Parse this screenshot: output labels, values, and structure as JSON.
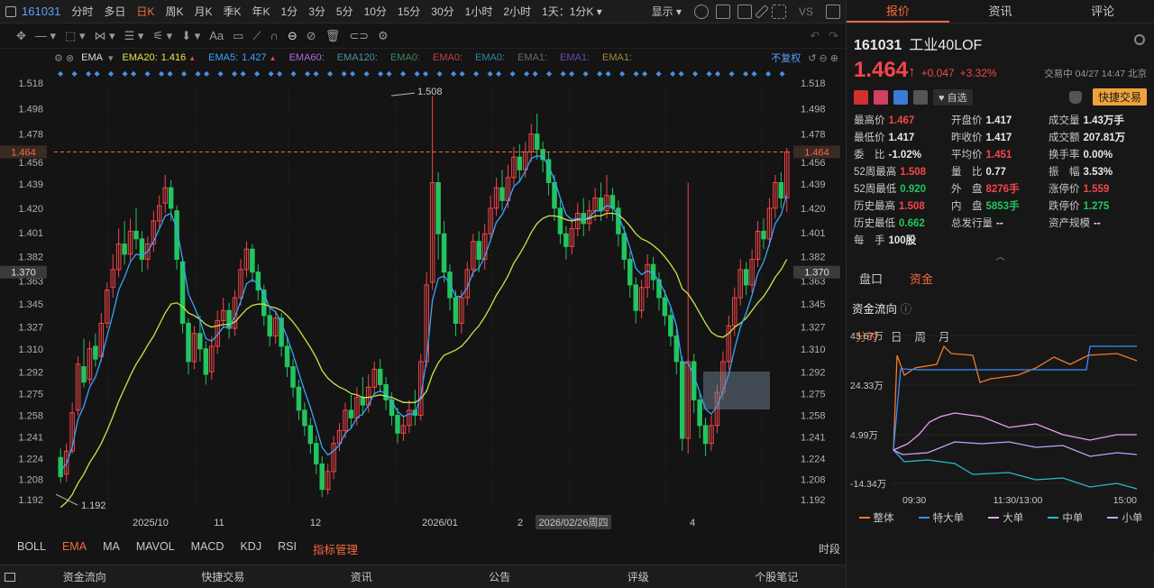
{
  "topbar": {
    "code": "161031",
    "periods": [
      "分时",
      "多日",
      "日K",
      "周K",
      "月K",
      "季K",
      "年K",
      "1分",
      "3分",
      "5分",
      "10分",
      "15分",
      "30分",
      "1小时",
      "2小时"
    ],
    "active_period": "日K",
    "range_select": "1天：1分K",
    "display_label": "显示",
    "vs_label": "VS"
  },
  "indicator_bar": {
    "type": "EMA",
    "items": [
      {
        "label": "EMA20:",
        "value": "1.416",
        "color": "#e6e649"
      },
      {
        "label": "EMA5:",
        "value": "1.427",
        "color": "#3ba3ff"
      },
      {
        "label": "EMA60:",
        "value": "",
        "color": "#b06ad6"
      },
      {
        "label": "EMA120:",
        "value": "",
        "color": "#4a90a4"
      },
      {
        "label": "EMA0:",
        "value": "",
        "color": "#3a8a5a"
      },
      {
        "label": "EMA0:",
        "value": "",
        "color": "#c04040"
      },
      {
        "label": "EMA0:",
        "value": "",
        "color": "#2a8aa4"
      },
      {
        "label": "EMA1:",
        "value": "",
        "color": "#6a6a6a"
      },
      {
        "label": "EMA1:",
        "value": "",
        "color": "#6a4aa4"
      },
      {
        "label": "EMA1:",
        "value": "",
        "color": "#a48a3a"
      }
    ],
    "rights_label": "不复权"
  },
  "chart_data": {
    "type": "candlestick",
    "y_ticks": [
      "1.518",
      "1.498",
      "1.478",
      "1.456",
      "1.439",
      "1.420",
      "1.401",
      "1.382",
      "1.363",
      "1.345",
      "1.327",
      "1.310",
      "1.292",
      "1.275",
      "1.258",
      "1.241",
      "1.224",
      "1.208",
      "1.192"
    ],
    "ylim": [
      1.185,
      1.525
    ],
    "current_price_label": "1.464",
    "crosshair_label": "1.370",
    "high_annotation": "1.508",
    "low_annotation": "1.192",
    "x_labels": [
      "2025/10",
      "11",
      "12",
      "2026/01",
      "2",
      "2026/02/26周四",
      "4"
    ],
    "candles": [
      [
        1.225,
        1.21,
        1.232,
        1.205
      ],
      [
        1.212,
        1.23,
        1.236,
        1.206
      ],
      [
        1.23,
        1.26,
        1.268,
        1.228
      ],
      [
        1.262,
        1.298,
        1.304,
        1.258
      ],
      [
        1.296,
        1.284,
        1.318,
        1.28
      ],
      [
        1.286,
        1.31,
        1.316,
        1.282
      ],
      [
        1.312,
        1.302,
        1.322,
        1.296
      ],
      [
        1.304,
        1.33,
        1.338,
        1.3
      ],
      [
        1.33,
        1.356,
        1.362,
        1.326
      ],
      [
        1.358,
        1.372,
        1.384,
        1.35
      ],
      [
        1.372,
        1.392,
        1.404,
        1.366
      ],
      [
        1.392,
        1.384,
        1.41,
        1.376
      ],
      [
        1.384,
        1.402,
        1.412,
        1.378
      ],
      [
        1.402,
        1.396,
        1.42,
        1.388
      ],
      [
        1.396,
        1.38,
        1.402,
        1.37
      ],
      [
        1.38,
        1.392,
        1.398,
        1.372
      ],
      [
        1.392,
        1.41,
        1.418,
        1.386
      ],
      [
        1.41,
        1.422,
        1.43,
        1.404
      ],
      [
        1.424,
        1.436,
        1.446,
        1.416
      ],
      [
        1.436,
        1.42,
        1.442,
        1.41
      ],
      [
        1.418,
        1.38,
        1.422,
        1.372
      ],
      [
        1.378,
        1.33,
        1.382,
        1.322
      ],
      [
        1.33,
        1.3,
        1.334,
        1.29
      ],
      [
        1.3,
        1.322,
        1.328,
        1.294
      ],
      [
        1.322,
        1.31,
        1.336,
        1.3
      ],
      [
        1.31,
        1.29,
        1.316,
        1.282
      ],
      [
        1.292,
        1.312,
        1.32,
        1.286
      ],
      [
        1.312,
        1.332,
        1.34,
        1.306
      ],
      [
        1.332,
        1.34,
        1.35,
        1.326
      ],
      [
        1.34,
        1.326,
        1.346,
        1.318
      ],
      [
        1.326,
        1.35,
        1.356,
        1.32
      ],
      [
        1.35,
        1.372,
        1.38,
        1.344
      ],
      [
        1.372,
        1.388,
        1.394,
        1.366
      ],
      [
        1.388,
        1.37,
        1.392,
        1.362
      ],
      [
        1.37,
        1.356,
        1.376,
        1.348
      ],
      [
        1.356,
        1.336,
        1.36,
        1.328
      ],
      [
        1.336,
        1.32,
        1.342,
        1.312
      ],
      [
        1.32,
        1.334,
        1.34,
        1.314
      ],
      [
        1.334,
        1.312,
        1.338,
        1.304
      ],
      [
        1.312,
        1.296,
        1.318,
        1.288
      ],
      [
        1.296,
        1.28,
        1.302,
        1.272
      ],
      [
        1.28,
        1.262,
        1.286,
        1.254
      ],
      [
        1.262,
        1.25,
        1.268,
        1.242
      ],
      [
        1.25,
        1.236,
        1.256,
        1.228
      ],
      [
        1.236,
        1.22,
        1.242,
        1.212
      ],
      [
        1.22,
        1.2,
        1.226,
        1.194
      ],
      [
        1.2,
        1.214,
        1.22,
        1.196
      ],
      [
        1.214,
        1.236,
        1.242,
        1.208
      ],
      [
        1.236,
        1.246,
        1.252,
        1.23
      ],
      [
        1.246,
        1.262,
        1.268,
        1.24
      ],
      [
        1.262,
        1.256,
        1.274,
        1.248
      ],
      [
        1.256,
        1.272,
        1.28,
        1.25
      ],
      [
        1.272,
        1.266,
        1.288,
        1.258
      ],
      [
        1.266,
        1.28,
        1.29,
        1.26
      ],
      [
        1.28,
        1.294,
        1.3,
        1.274
      ],
      [
        1.294,
        1.282,
        1.302,
        1.276
      ],
      [
        1.282,
        1.27,
        1.288,
        1.262
      ],
      [
        1.27,
        1.258,
        1.276,
        1.25
      ],
      [
        1.258,
        1.244,
        1.264,
        1.236
      ],
      [
        1.244,
        1.25,
        1.258,
        1.238
      ],
      [
        1.25,
        1.262,
        1.27,
        1.244
      ],
      [
        1.262,
        1.258,
        1.278,
        1.25
      ],
      [
        1.258,
        1.3,
        1.306,
        1.254
      ],
      [
        1.3,
        1.36,
        1.37,
        1.296
      ],
      [
        1.362,
        1.44,
        1.508,
        1.356
      ],
      [
        1.44,
        1.4,
        1.448,
        1.38
      ],
      [
        1.4,
        1.37,
        1.41,
        1.362
      ],
      [
        1.37,
        1.35,
        1.376,
        1.34
      ],
      [
        1.35,
        1.33,
        1.356,
        1.32
      ],
      [
        1.33,
        1.35,
        1.356,
        1.322
      ],
      [
        1.35,
        1.372,
        1.378,
        1.344
      ],
      [
        1.372,
        1.394,
        1.4,
        1.366
      ],
      [
        1.394,
        1.38,
        1.402,
        1.37
      ],
      [
        1.38,
        1.4,
        1.408,
        1.372
      ],
      [
        1.4,
        1.42,
        1.43,
        1.394
      ],
      [
        1.42,
        1.436,
        1.444,
        1.414
      ],
      [
        1.436,
        1.426,
        1.45,
        1.418
      ],
      [
        1.426,
        1.444,
        1.454,
        1.42
      ],
      [
        1.444,
        1.46,
        1.468,
        1.438
      ],
      [
        1.46,
        1.45,
        1.47,
        1.44
      ],
      [
        1.45,
        1.464,
        1.472,
        1.444
      ],
      [
        1.464,
        1.478,
        1.486,
        1.456
      ],
      [
        1.478,
        1.466,
        1.494,
        1.458
      ],
      [
        1.466,
        1.458,
        1.472,
        1.448
      ],
      [
        1.458,
        1.44,
        1.464,
        1.43
      ],
      [
        1.44,
        1.42,
        1.446,
        1.41
      ],
      [
        1.42,
        1.4,
        1.426,
        1.392
      ],
      [
        1.4,
        1.39,
        1.406,
        1.38
      ],
      [
        1.39,
        1.404,
        1.412,
        1.384
      ],
      [
        1.404,
        1.416,
        1.424,
        1.398
      ],
      [
        1.416,
        1.408,
        1.428,
        1.398
      ],
      [
        1.408,
        1.418,
        1.426,
        1.402
      ],
      [
        1.418,
        1.428,
        1.436,
        1.41
      ],
      [
        1.428,
        1.418,
        1.44,
        1.41
      ],
      [
        1.418,
        1.43,
        1.446,
        1.412
      ],
      [
        1.43,
        1.42,
        1.436,
        1.41
      ],
      [
        1.42,
        1.4,
        1.426,
        1.39
      ],
      [
        1.4,
        1.38,
        1.406,
        1.372
      ],
      [
        1.38,
        1.36,
        1.386,
        1.35
      ],
      [
        1.36,
        1.34,
        1.366,
        1.33
      ],
      [
        1.34,
        1.358,
        1.364,
        1.334
      ],
      [
        1.358,
        1.376,
        1.384,
        1.35
      ],
      [
        1.376,
        1.364,
        1.382,
        1.356
      ],
      [
        1.364,
        1.35,
        1.37,
        1.34
      ],
      [
        1.35,
        1.336,
        1.356,
        1.328
      ],
      [
        1.336,
        1.32,
        1.342,
        1.312
      ],
      [
        1.32,
        1.3,
        1.326,
        1.29
      ],
      [
        1.3,
        1.24,
        1.304,
        1.23
      ],
      [
        1.24,
        1.3,
        1.44,
        1.228
      ],
      [
        1.3,
        1.27,
        1.306,
        1.26
      ],
      [
        1.27,
        1.25,
        1.276,
        1.24
      ],
      [
        1.25,
        1.236,
        1.256,
        1.226
      ],
      [
        1.236,
        1.25,
        1.258,
        1.23
      ],
      [
        1.25,
        1.276,
        1.282,
        1.244
      ],
      [
        1.276,
        1.3,
        1.308,
        1.27
      ],
      [
        1.3,
        1.328,
        1.336,
        1.294
      ],
      [
        1.328,
        1.35,
        1.358,
        1.32
      ],
      [
        1.35,
        1.372,
        1.38,
        1.344
      ],
      [
        1.372,
        1.36,
        1.378,
        1.352
      ],
      [
        1.36,
        1.38,
        1.388,
        1.354
      ],
      [
        1.38,
        1.402,
        1.41,
        1.374
      ],
      [
        1.402,
        1.396,
        1.412,
        1.388
      ],
      [
        1.396,
        1.42,
        1.428,
        1.39
      ],
      [
        1.42,
        1.44,
        1.446,
        1.412
      ],
      [
        1.44,
        1.428,
        1.448,
        1.42
      ],
      [
        1.428,
        1.464,
        1.467,
        1.417
      ]
    ],
    "ema5": [
      1.215,
      1.22,
      1.233,
      1.255,
      1.265,
      1.28,
      1.288,
      1.302,
      1.32,
      1.337,
      1.356,
      1.366,
      1.378,
      1.384,
      1.383,
      1.386,
      1.394,
      1.404,
      1.414,
      1.416,
      1.404,
      1.38,
      1.353,
      1.343,
      1.332,
      1.318,
      1.316,
      1.321,
      1.327,
      1.327,
      1.335,
      1.347,
      1.361,
      1.364,
      1.361,
      1.353,
      1.342,
      1.339,
      1.33,
      1.319,
      1.306,
      1.291,
      1.277,
      1.264,
      1.249,
      1.233,
      1.227,
      1.23,
      1.235,
      1.244,
      1.248,
      1.256,
      1.259,
      1.266,
      1.275,
      1.277,
      1.275,
      1.269,
      1.261,
      1.257,
      1.259,
      1.259,
      1.273,
      1.302,
      1.348,
      1.365,
      1.367,
      1.361,
      1.351,
      1.351,
      1.358,
      1.37,
      1.373,
      1.382,
      1.395,
      1.409,
      1.415,
      1.425,
      1.437,
      1.441,
      1.449,
      1.459,
      1.461,
      1.46,
      1.453,
      1.442,
      1.428,
      1.415,
      1.411,
      1.412,
      1.411,
      1.413,
      1.418,
      1.418,
      1.422,
      1.421,
      1.414,
      1.403,
      1.389,
      1.373,
      1.368,
      1.371,
      1.369,
      1.363,
      1.354,
      1.343,
      1.328,
      1.299,
      1.299,
      1.289,
      1.276,
      1.263,
      1.259,
      1.265,
      1.277,
      1.29,
      1.31,
      1.327,
      1.338,
      1.352,
      1.369,
      1.378,
      1.392,
      1.408,
      1.415,
      1.431
    ],
    "ema20": [
      1.186,
      1.19,
      1.196,
      1.205,
      1.212,
      1.221,
      1.228,
      1.236,
      1.246,
      1.257,
      1.269,
      1.279,
      1.289,
      1.298,
      1.305,
      1.313,
      1.32,
      1.329,
      1.338,
      1.345,
      1.346,
      1.343,
      1.338,
      1.336,
      1.333,
      1.329,
      1.327,
      1.328,
      1.329,
      1.329,
      1.331,
      1.336,
      1.341,
      1.344,
      1.345,
      1.345,
      1.343,
      1.342,
      1.34,
      1.336,
      1.331,
      1.325,
      1.318,
      1.311,
      1.303,
      1.293,
      1.287,
      1.283,
      1.28,
      1.278,
      1.275,
      1.274,
      1.272,
      1.272,
      1.273,
      1.274,
      1.273,
      1.272,
      1.27,
      1.268,
      1.268,
      1.268,
      1.271,
      1.277,
      1.29,
      1.299,
      1.305,
      1.307,
      1.309,
      1.312,
      1.317,
      1.323,
      1.328,
      1.335,
      1.343,
      1.352,
      1.359,
      1.367,
      1.377,
      1.384,
      1.392,
      1.401,
      1.408,
      1.412,
      1.414,
      1.414,
      1.413,
      1.411,
      1.41,
      1.411,
      1.411,
      1.412,
      1.414,
      1.414,
      1.416,
      1.416,
      1.415,
      1.411,
      1.406,
      1.4,
      1.396,
      1.394,
      1.391,
      1.387,
      1.382,
      1.376,
      1.369,
      1.357,
      1.353,
      1.346,
      1.338,
      1.33,
      1.323,
      1.32,
      1.319,
      1.322,
      1.327,
      1.33,
      1.334,
      1.34,
      1.346,
      1.351,
      1.358,
      1.366,
      1.372,
      1.38
    ]
  },
  "bottom_tabs": [
    "BOLL",
    "EMA",
    "MA",
    "MAVOL",
    "MACD",
    "KDJ",
    "RSI",
    "指标管理"
  ],
  "bottom_active": "EMA",
  "bottom_right": "时段",
  "footer": [
    "资金流向",
    "快捷交易",
    "资讯",
    "公告",
    "评级",
    "个股笔记"
  ],
  "right_panel": {
    "tabs": [
      "报价",
      "资讯",
      "评论"
    ],
    "active_tab": "报价",
    "stock_code": "161031",
    "stock_name": "工业40LOF",
    "price": "1.464",
    "change": "+0.047",
    "change_pct": "+3.32%",
    "status": "交易中 04/27 14:47 北京",
    "watch_label": "自选",
    "quick_trade": "快捷交易",
    "quotes": [
      [
        {
          "k": "最高价",
          "v": "1.467",
          "c": "red"
        },
        {
          "k": "开盘价",
          "v": "1.417",
          "c": "white"
        },
        {
          "k": "成交量",
          "v": "1.43万手",
          "c": "white"
        }
      ],
      [
        {
          "k": "最低价",
          "v": "1.417",
          "c": "white"
        },
        {
          "k": "昨收价",
          "v": "1.417",
          "c": "white"
        },
        {
          "k": "成交额",
          "v": "207.81万",
          "c": "white"
        }
      ],
      [
        {
          "k": "委　比",
          "v": "-1.02%",
          "c": "white"
        },
        {
          "k": "平均价",
          "v": "1.451",
          "c": "red"
        },
        {
          "k": "换手率",
          "v": "0.00%",
          "c": "white"
        }
      ],
      [
        {
          "k": "52周最高",
          "v": "1.508",
          "c": "red"
        },
        {
          "k": "量　比",
          "v": "0.77",
          "c": "white"
        },
        {
          "k": "振　幅",
          "v": "3.53%",
          "c": "white"
        }
      ],
      [
        {
          "k": "52周最低",
          "v": "0.920",
          "c": "green"
        },
        {
          "k": "外　盘",
          "v": "8276手",
          "c": "red"
        },
        {
          "k": "涨停价",
          "v": "1.559",
          "c": "red"
        }
      ],
      [
        {
          "k": "历史最高",
          "v": "1.508",
          "c": "red"
        },
        {
          "k": "内　盘",
          "v": "5853手",
          "c": "green"
        },
        {
          "k": "跌停价",
          "v": "1.275",
          "c": "green"
        }
      ],
      [
        {
          "k": "历史最低",
          "v": "0.662",
          "c": "green"
        },
        {
          "k": "总发行量",
          "v": "--",
          "c": "white"
        },
        {
          "k": "资产规模",
          "v": "--",
          "c": "white"
        }
      ],
      [
        {
          "k": "每　手",
          "v": "100股",
          "c": "white"
        },
        {
          "k": "",
          "v": "",
          "c": "white"
        },
        {
          "k": "",
          "v": "",
          "c": "white"
        }
      ]
    ],
    "sub_tabs": [
      "盘口",
      "资金"
    ],
    "sub_active": "资金",
    "flow_title": "资金流向",
    "flow_periods": [
      "分时",
      "日",
      "周",
      "月"
    ],
    "flow_active": "分时",
    "flow_y": [
      "43.67万",
      "24.33万",
      "4.99万",
      "-14.34万"
    ],
    "flow_x": [
      "09:30",
      "11:30/13:00",
      "15:00"
    ],
    "flow_legend": [
      {
        "name": "整体",
        "color": "#f07a2a"
      },
      {
        "name": "特大单",
        "color": "#3b8bff"
      },
      {
        "name": "大单",
        "color": "#e8a0f0"
      },
      {
        "name": "中单",
        "color": "#2ab8d0"
      },
      {
        "name": "小单",
        "color": "#c8a0ff"
      }
    ]
  }
}
